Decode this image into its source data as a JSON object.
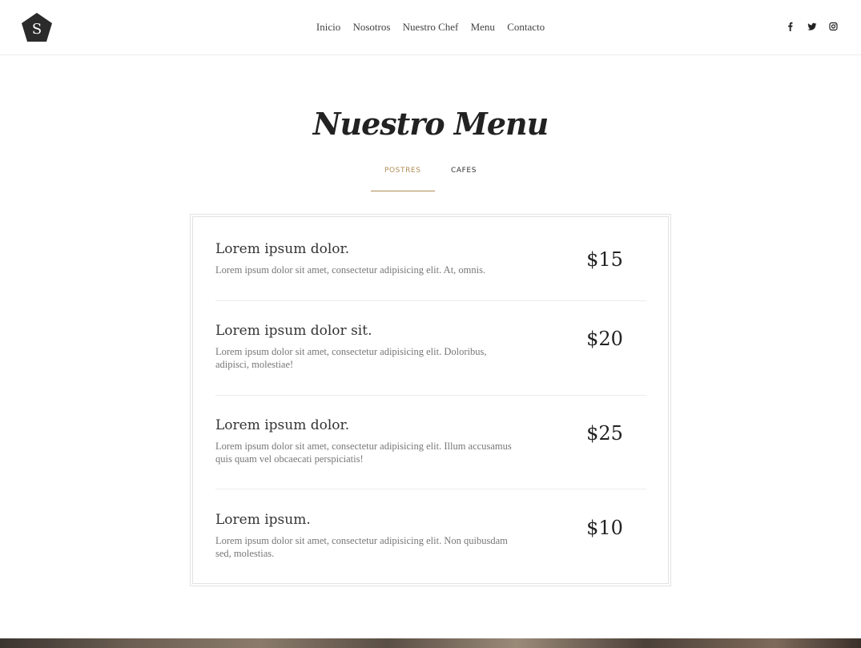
{
  "header": {
    "logo_letter": "S",
    "nav": [
      "Inicio",
      "Nosotros",
      "Nuestro Chef",
      "Menu",
      "Contacto"
    ],
    "social_icons": [
      "facebook-icon",
      "twitter-icon",
      "instagram-icon"
    ]
  },
  "section": {
    "title": "Nuestro Menu",
    "tabs": [
      {
        "label": "POSTRES",
        "active": true
      },
      {
        "label": "CAFES",
        "active": false
      }
    ]
  },
  "menu_items": [
    {
      "name": "Lorem ipsum dolor.",
      "description": "Lorem ipsum dolor sit amet, consectetur adipisicing elit. At, omnis.",
      "price": "$15"
    },
    {
      "name": "Lorem ipsum dolor sit.",
      "description": "Lorem ipsum dolor sit amet, consectetur adipisicing elit. Doloribus, adipisci, molestiae!",
      "price": "$20"
    },
    {
      "name": "Lorem ipsum dolor.",
      "description": "Lorem ipsum dolor sit amet, consectetur adipisicing elit. Illum accusamus quis quam vel obcaecati perspiciatis!",
      "price": "$25"
    },
    {
      "name": "Lorem ipsum.",
      "description": "Lorem ipsum dolor sit amet, consectetur adipisicing elit. Non quibusdam sed, molestias.",
      "price": "$10"
    }
  ],
  "colors": {
    "accent": "#b08d57",
    "text": "#222222",
    "muted": "#777777",
    "border": "#e2e2e2"
  }
}
